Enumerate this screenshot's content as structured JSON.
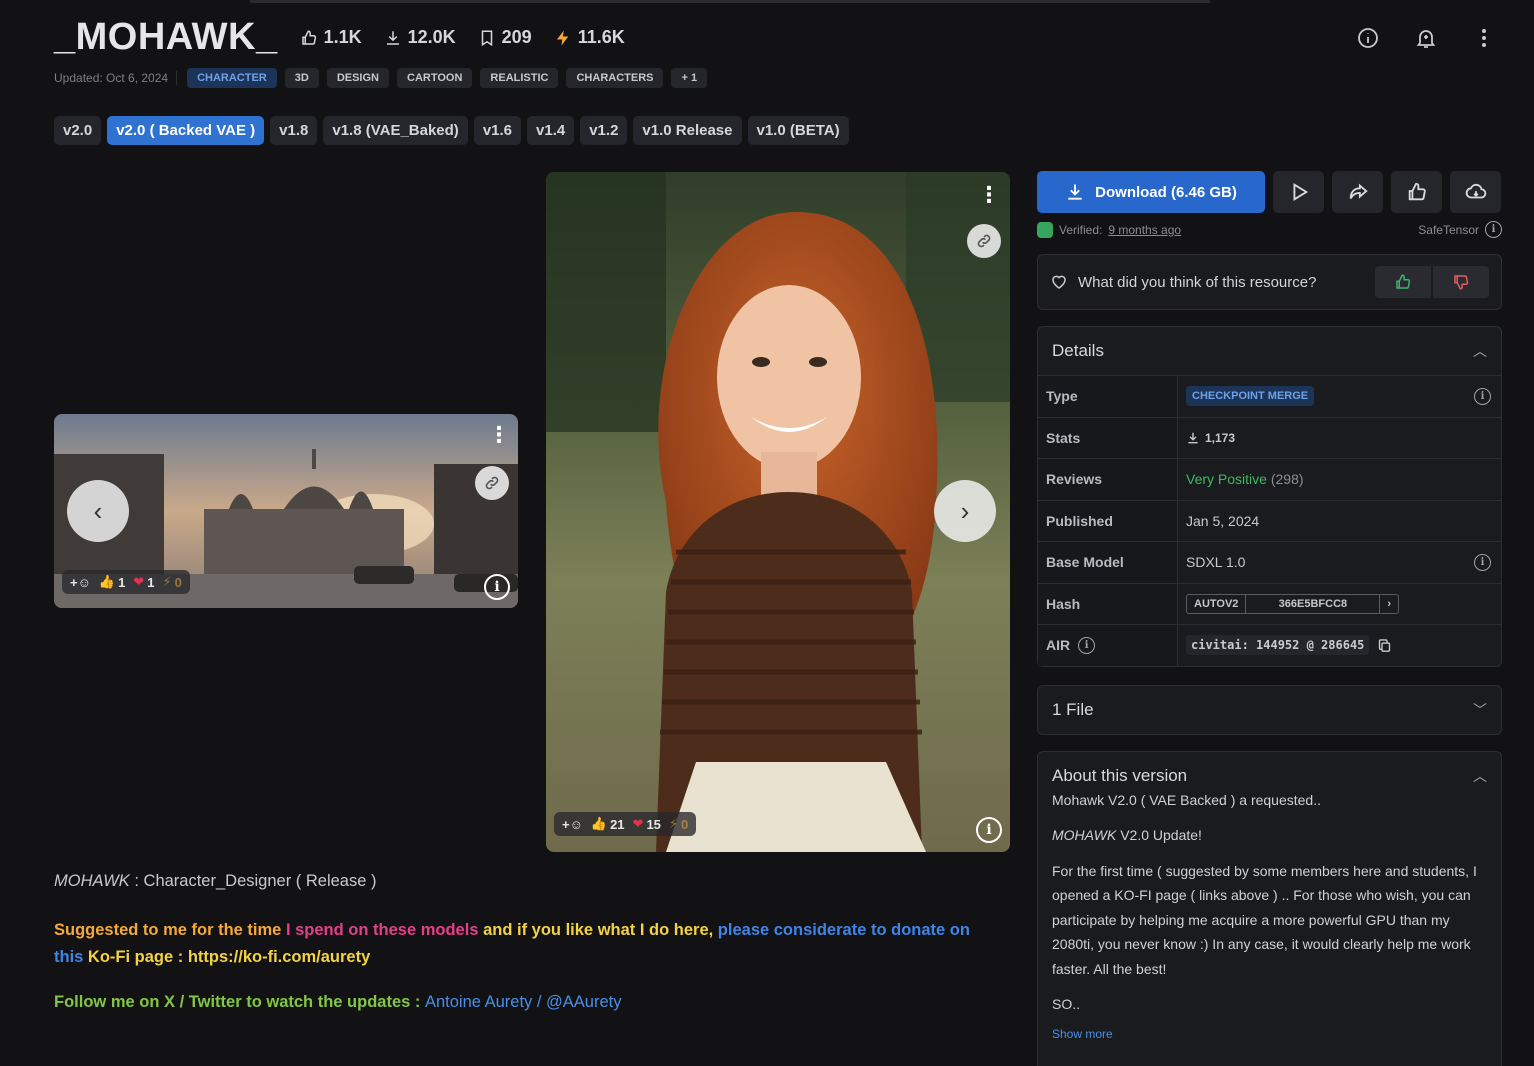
{
  "header": {
    "title": "_MOHAWK_",
    "stats": {
      "likes": "1.1K",
      "downloads": "12.0K",
      "bookmarks": "209",
      "buzz": "11.6K"
    },
    "updated": "Updated: Oct 6, 2024",
    "tags": [
      "CHARACTER",
      "3D",
      "DESIGN",
      "CARTOON",
      "REALISTIC",
      "CHARACTERS",
      "+ 1"
    ]
  },
  "versions": [
    "v2.0",
    "v2.0 ( Backed VAE )",
    "v1.8",
    "v1.8 (VAE_Baked)",
    "v1.6",
    "v1.4",
    "v1.2",
    "v1.0 Release",
    "v1.0 (BETA)"
  ],
  "gallery": {
    "thumb": {
      "like": "1",
      "heart": "1",
      "buzz": "0"
    },
    "main": {
      "like": "21",
      "heart": "15",
      "buzz": "0"
    }
  },
  "actions": {
    "download": "Download (6.46 GB)",
    "verified": "Verified:",
    "verified_when": "9 months ago",
    "safetensor": "SafeTensor"
  },
  "feedback": {
    "question": "What did you think of this resource?"
  },
  "details": {
    "title": "Details",
    "type_label": "Type",
    "type_value": "CHECKPOINT MERGE",
    "stats_label": "Stats",
    "stats_value": "1,173",
    "reviews_label": "Reviews",
    "reviews_value": "Very Positive",
    "reviews_count": "(298)",
    "published_label": "Published",
    "published_value": "Jan 5, 2024",
    "base_label": "Base Model",
    "base_value": "SDXL 1.0",
    "hash_label": "Hash",
    "hash_algo": "AUTOV2",
    "hash_value": "366E5BFCC8",
    "air_label": "AIR",
    "air_value": "civitai: 144952 @ 286645"
  },
  "files": {
    "title": "1 File"
  },
  "about": {
    "title": "About this version",
    "p1": "Mohawk V2.0 ( VAE Backed ) a requested..",
    "p2_italic": "MOHAWK",
    "p2_rest": " V2.0 Update!",
    "p3": "For the first time ( suggested by some members here and students, I opened a KO-FI page ( links above ) .. For those who wish, you can participate by helping me acquire a more powerful GPU than my 2080ti, you never know :) In any case, it would clearly help me work faster. All the best!",
    "p4": "SO..",
    "show_more": "Show more"
  },
  "description": {
    "l1_italic": "MOHAWK",
    "l1_rest": " : Character_Designer ( Release )",
    "s1": "Suggested to me for the time ",
    "s2": "I spend on these models",
    "s3": " and if you like what I do here, ",
    "s4": "please considerate to donate on this",
    "s5": " Ko-Fi page : https://ko-fi.com/aurety",
    "f1": "Follow me on X / Twitter to watch the updates : ",
    "f2": "Antoine Aurety / @AAurety"
  },
  "colors": {
    "accent": "#2867cc",
    "positive": "#40b860",
    "tag_blue": "#6ea2e8"
  }
}
